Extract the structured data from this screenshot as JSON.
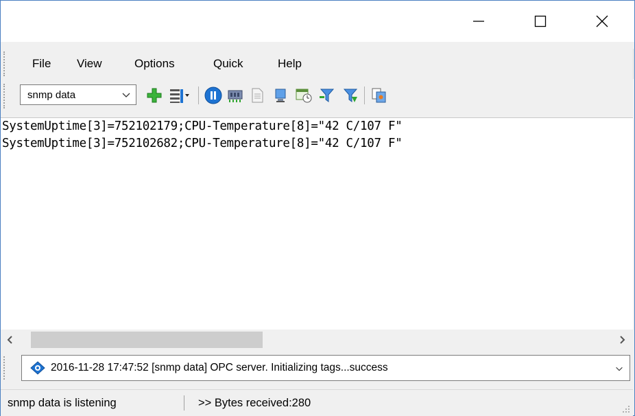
{
  "window": {
    "minimize_icon": "minimize-icon",
    "maximize_icon": "maximize-icon",
    "close_icon": "close-icon"
  },
  "menu": {
    "items": [
      "File",
      "View",
      "Options",
      "Quick",
      "Help"
    ]
  },
  "toolbar": {
    "source_select": "snmp data",
    "icons": [
      "add-icon",
      "columns-icon",
      "pause-icon",
      "memory-icon",
      "document-icon",
      "monitor-icon",
      "scheduler-icon",
      "filter-icon",
      "filter-edit-icon",
      "copy-icon"
    ]
  },
  "data_lines": [
    "SystemUptime[3]=752102179;CPU-Temperature[8]=\"42 C/107 F\"",
    "SystemUptime[3]=752102682;CPU-Temperature[8]=\"42 C/107 F\""
  ],
  "log": {
    "message": "2016-11-28 17:47:52 [snmp data] OPC server. Initializing tags...success",
    "icon": "info-icon"
  },
  "status": {
    "state": "snmp data is listening",
    "bytes": ">> Bytes received:280"
  },
  "colors": {
    "accent": "#1e73d2",
    "add_green": "#2fa52f"
  }
}
